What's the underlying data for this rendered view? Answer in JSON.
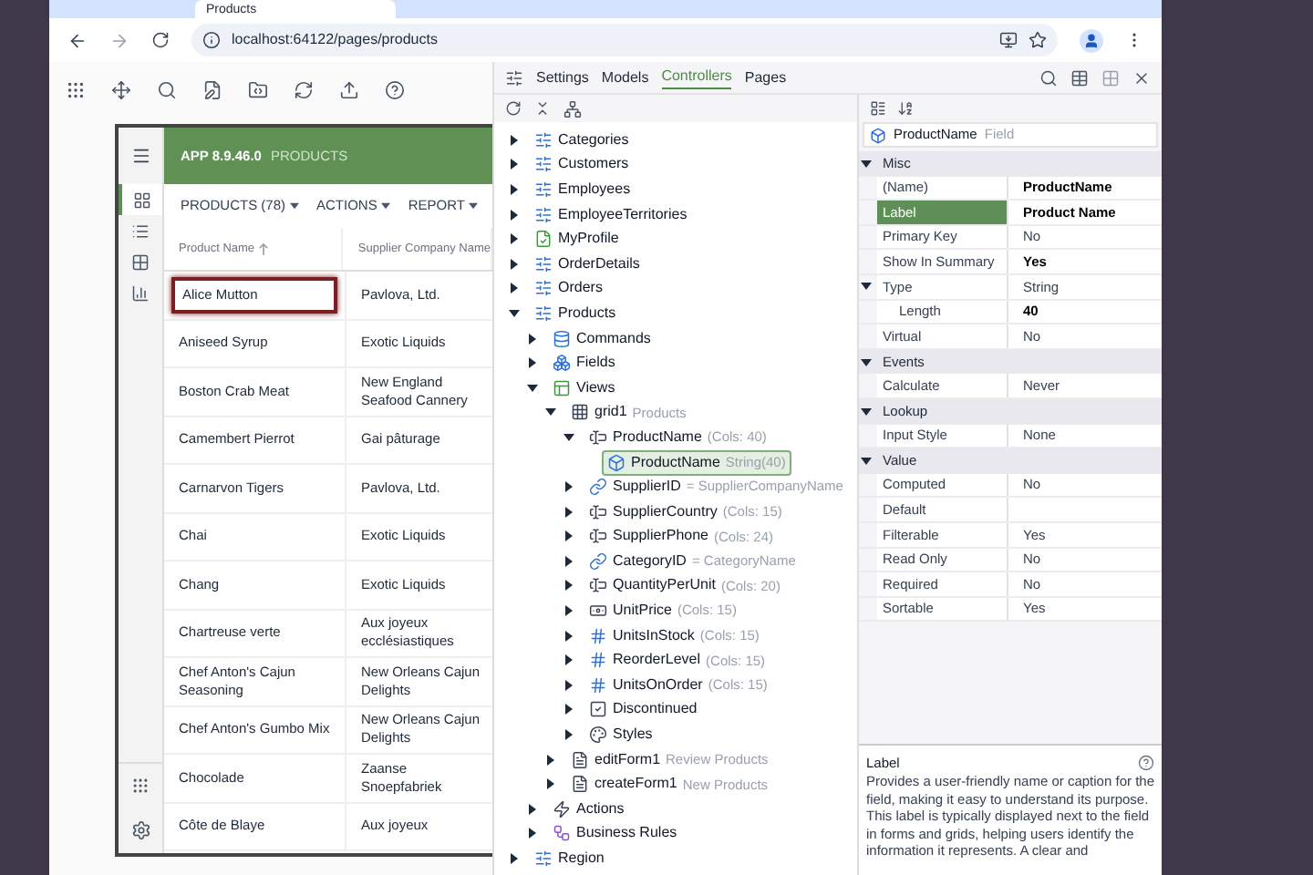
{
  "browser": {
    "tab_title": "Products",
    "url": "localhost:64122/pages/products"
  },
  "app": {
    "version": "APP 8.9.46.0",
    "page": "PRODUCTS",
    "rail": [
      {
        "kind": "grid",
        "selected": true
      },
      {
        "kind": "list",
        "selected": false
      },
      {
        "kind": "cards",
        "selected": false
      },
      {
        "kind": "chart",
        "selected": false
      }
    ],
    "menus": [
      "PRODUCTS (78)",
      "ACTIONS",
      "REPORT"
    ],
    "columns": [
      {
        "label": "Product Name",
        "sorted": true
      },
      {
        "label": "Supplier Company Name",
        "sorted": false
      }
    ],
    "rows": [
      {
        "product": "Alice Mutton",
        "supplier": "Pavlova, Ltd.",
        "selected": true
      },
      {
        "product": "Aniseed Syrup",
        "supplier": "Exotic Liquids",
        "selected": false
      },
      {
        "product": "Boston Crab Meat",
        "supplier": "New England Seafood Cannery",
        "selected": false
      },
      {
        "product": "Camembert Pierrot",
        "supplier": "Gai pâturage",
        "selected": false
      },
      {
        "product": "Carnarvon Tigers",
        "supplier": "Pavlova, Ltd.",
        "selected": false
      },
      {
        "product": "Chai",
        "supplier": "Exotic Liquids",
        "selected": false
      },
      {
        "product": "Chang",
        "supplier": "Exotic Liquids",
        "selected": false
      },
      {
        "product": "Chartreuse verte",
        "supplier": "Aux joyeux ecclésiastiques",
        "selected": false
      },
      {
        "product": "Chef Anton's Cajun Seasoning",
        "supplier": "New Orleans Cajun Delights",
        "selected": false
      },
      {
        "product": "Chef Anton's Gumbo Mix",
        "supplier": "New Orleans Cajun Delights",
        "selected": false
      },
      {
        "product": "Chocolade",
        "supplier": "Zaanse Snoepfabriek",
        "selected": false
      },
      {
        "product": "Côte de Blaye",
        "supplier": "Aux joyeux",
        "selected": false
      }
    ]
  },
  "designer": {
    "tabs": [
      {
        "label": "Settings",
        "selected": false
      },
      {
        "label": "Models",
        "selected": false
      },
      {
        "label": "Controllers",
        "selected": true
      },
      {
        "label": "Pages",
        "selected": false
      }
    ],
    "tree": [
      {
        "label": "Categories",
        "kind": "controller",
        "expanded": false
      },
      {
        "label": "Customers",
        "kind": "controller",
        "expanded": false
      },
      {
        "label": "Employees",
        "kind": "controller",
        "expanded": false
      },
      {
        "label": "EmployeeTerritories",
        "kind": "controller",
        "expanded": false
      },
      {
        "label": "MyProfile",
        "kind": "profile",
        "expanded": false
      },
      {
        "label": "OrderDetails",
        "kind": "controller",
        "expanded": false
      },
      {
        "label": "Orders",
        "kind": "controller",
        "expanded": false
      },
      {
        "label": "Products",
        "kind": "controller",
        "expanded": true,
        "children": [
          {
            "label": "Commands",
            "kind": "commands",
            "expanded": false
          },
          {
            "label": "Fields",
            "kind": "fields",
            "expanded": false
          },
          {
            "label": "Views",
            "kind": "views",
            "expanded": true,
            "children": [
              {
                "label": "grid1",
                "note": "Products",
                "kind": "grid",
                "expanded": true,
                "children": [
                  {
                    "label": "ProductName",
                    "note": "(Cols: 40)",
                    "kind": "text",
                    "expanded": true,
                    "children": [
                      {
                        "label": "ProductName",
                        "note": "String(40)",
                        "kind": "field",
                        "selected": true
                      }
                    ]
                  },
                  {
                    "label": "SupplierID",
                    "note": "= SupplierCompanyName",
                    "kind": "lookup",
                    "expanded": false
                  },
                  {
                    "label": "SupplierCountry",
                    "note": "(Cols: 15)",
                    "kind": "text",
                    "expanded": false
                  },
                  {
                    "label": "SupplierPhone",
                    "note": "(Cols: 24)",
                    "kind": "text",
                    "expanded": false
                  },
                  {
                    "label": "CategoryID",
                    "note": "= CategoryName",
                    "kind": "lookup",
                    "expanded": false
                  },
                  {
                    "label": "QuantityPerUnit",
                    "note": "(Cols: 20)",
                    "kind": "text",
                    "expanded": false
                  },
                  {
                    "label": "UnitPrice",
                    "note": "(Cols: 15)",
                    "kind": "money",
                    "expanded": false
                  },
                  {
                    "label": "UnitsInStock",
                    "note": "(Cols: 15)",
                    "kind": "number",
                    "expanded": false
                  },
                  {
                    "label": "ReorderLevel",
                    "note": "(Cols: 15)",
                    "kind": "number",
                    "expanded": false
                  },
                  {
                    "label": "UnitsOnOrder",
                    "note": "(Cols: 15)",
                    "kind": "number",
                    "expanded": false
                  },
                  {
                    "label": "Discontinued",
                    "kind": "checkbox",
                    "expanded": false
                  },
                  {
                    "label": "Styles",
                    "kind": "styles",
                    "expanded": false
                  }
                ]
              },
              {
                "label": "editForm1",
                "note": "Review Products",
                "kind": "form",
                "expanded": false
              },
              {
                "label": "createForm1",
                "note": "New Products",
                "kind": "form",
                "expanded": false
              }
            ]
          },
          {
            "label": "Actions",
            "kind": "actions",
            "expanded": false
          },
          {
            "label": "Business Rules",
            "kind": "rules",
            "expanded": false
          }
        ]
      },
      {
        "label": "Region",
        "kind": "controller",
        "expanded": false
      }
    ],
    "properties": {
      "object": "ProductName",
      "object_type": "Field",
      "sections": [
        {
          "title": "Misc",
          "expanded": true,
          "rows": [
            {
              "name": "(Name)",
              "value": "ProductName",
              "modified": true,
              "selected": false
            },
            {
              "name": "Label",
              "value": "Product Name",
              "modified": true,
              "selected": true
            },
            {
              "name": "Primary Key",
              "value": "No",
              "modified": false,
              "selected": false
            },
            {
              "name": "Show In Summary",
              "value": "Yes",
              "modified": true,
              "selected": false
            },
            {
              "name": "Type",
              "value": "String",
              "modified": false,
              "selected": false,
              "expanded": true,
              "children": [
                {
                  "name": "Length",
                  "value": "40",
                  "modified": true,
                  "selected": false
                }
              ]
            },
            {
              "name": "Virtual",
              "value": "No",
              "modified": false,
              "selected": false
            }
          ]
        },
        {
          "title": "Events",
          "expanded": true,
          "rows": [
            {
              "name": "Calculate",
              "value": "Never",
              "modified": false,
              "selected": false
            }
          ]
        },
        {
          "title": "Lookup",
          "expanded": true,
          "rows": [
            {
              "name": "Input Style",
              "value": "None",
              "modified": false,
              "selected": false
            }
          ]
        },
        {
          "title": "Value",
          "expanded": true,
          "rows": [
            {
              "name": "Computed",
              "value": "No",
              "modified": false,
              "selected": false
            },
            {
              "name": "Default",
              "selected": false
            },
            {
              "name": "Filterable",
              "value": "Yes",
              "modified": false,
              "selected": false
            },
            {
              "name": "Read Only",
              "value": "No",
              "modified": false,
              "selected": false
            },
            {
              "name": "Required",
              "value": "No",
              "modified": false,
              "selected": false
            },
            {
              "name": "Sortable",
              "value": "Yes",
              "modified": false,
              "selected": false
            }
          ]
        }
      ],
      "help": {
        "title": "Label",
        "text": "Provides a user-friendly name or caption for the field, making it easy to understand its purpose. This label is typically displayed next to the field in forms and grids, helping users identify the information it represents. A clear and"
      }
    }
  }
}
